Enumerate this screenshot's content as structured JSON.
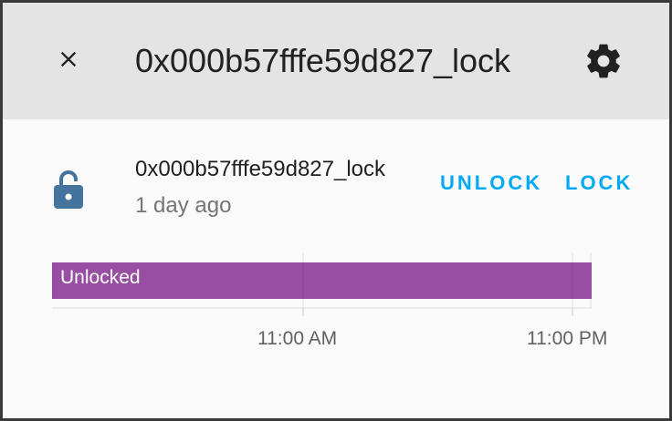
{
  "dialog": {
    "title": "0x000b57fffe59d827_lock",
    "close_icon": "close-icon",
    "settings_icon": "gear-icon"
  },
  "entity": {
    "icon": "lock-open-icon",
    "icon_color": "#44739e",
    "name": "0x000b57fffe59d827_lock",
    "last_changed": "1 day ago",
    "actions": {
      "unlock_label": "UNLOCK",
      "lock_label": "LOCK"
    },
    "accent_color": "#03a9f4"
  },
  "history": {
    "state_label": "Unlocked",
    "state_color": "#984ea3",
    "state_fraction": 1.0,
    "ticks": [
      "11:00 AM",
      "11:00 PM"
    ]
  }
}
